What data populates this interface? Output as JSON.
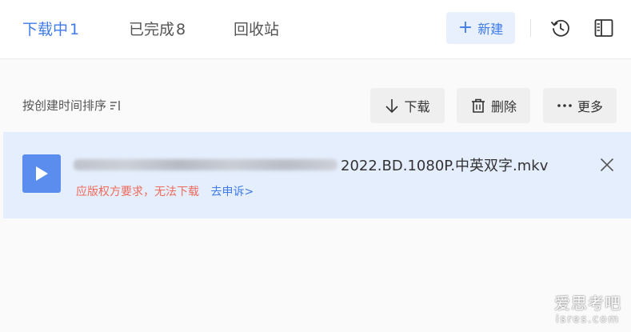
{
  "tabs": [
    {
      "label": "下载中",
      "count": "1",
      "active": true
    },
    {
      "label": "已完成",
      "count": "8",
      "active": false
    },
    {
      "label": "回收站",
      "count": "",
      "active": false
    }
  ],
  "header": {
    "new_label": "新建",
    "history_icon": "history-clock-icon",
    "panel_icon": "sidebar-panel-icon"
  },
  "toolbar": {
    "sort_label": "按创建时间排序",
    "download_label": "下载",
    "delete_label": "删除",
    "more_label": "更多"
  },
  "item": {
    "filename_visible": "2022.BD.1080P.中英双字.mkv",
    "status": "应版权方要求，无法下载",
    "appeal": "去申诉>"
  },
  "watermark": {
    "main": "爱思考吧",
    "sub": "isres.com"
  },
  "colors": {
    "accent": "#3f7be9",
    "warn": "#ef6a5a",
    "item_bg": "#e5eefd"
  }
}
